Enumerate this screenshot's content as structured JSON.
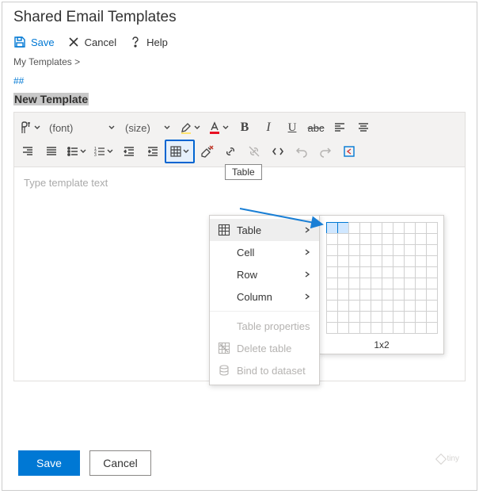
{
  "window": {
    "title": "Shared Email Templates"
  },
  "topbar": {
    "save": "Save",
    "cancel": "Cancel",
    "help": "Help"
  },
  "breadcrumb": "My Templates >",
  "marker": "##",
  "template_name": "New Template",
  "toolbar": {
    "font_label": "(font)",
    "size_label": "(size)"
  },
  "tooltip": "Table",
  "table_menu": {
    "table": "Table",
    "cell": "Cell",
    "row": "Row",
    "column": "Column",
    "properties": "Table properties",
    "delete": "Delete table",
    "bind": "Bind to dataset"
  },
  "grid_picker": {
    "selection_label": "1x2"
  },
  "editor": {
    "placeholder": "Type template text"
  },
  "buttons": {
    "save": "Save",
    "cancel": "Cancel"
  },
  "footer": {
    "logo": "tiny"
  },
  "colors": {
    "accent": "#0078d4",
    "highlight_border": "#0065d1"
  }
}
